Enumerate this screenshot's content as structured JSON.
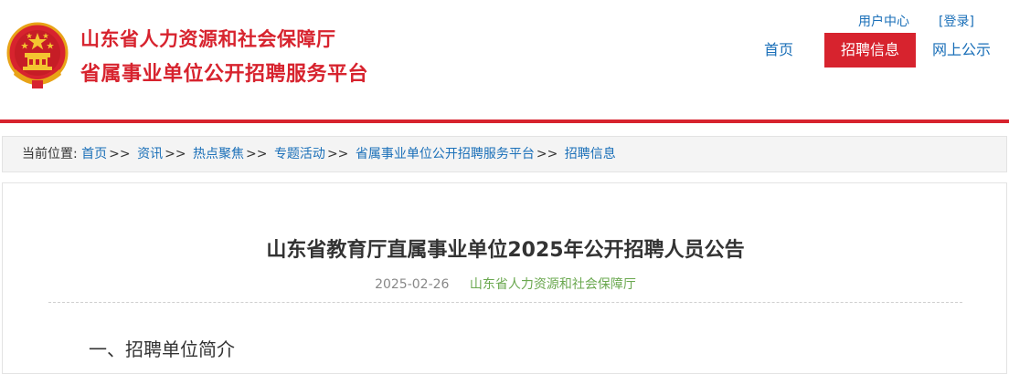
{
  "header": {
    "org_line1": "山东省人力资源和社会保障厅",
    "org_line2": "省属事业单位公开招聘服务平台",
    "user_center": "用户中心",
    "login": "[登录]",
    "nav": [
      "首页",
      "招聘信息",
      "网上公示"
    ],
    "active_nav": "招聘信息"
  },
  "breadcrumb": {
    "prefix": "当前位置:",
    "items": [
      "首页",
      "资讯",
      "热点聚焦",
      "专题活动",
      "省属事业单位公开招聘服务平台",
      "招聘信息"
    ],
    "separator": ">>"
  },
  "article": {
    "title": "山东省教育厅直属事业单位2025年公开招聘人员公告",
    "date": "2025-02-26",
    "source": "山东省人力资源和社会保障厅",
    "section_heading": "一、招聘单位简介"
  },
  "colors": {
    "brand_red": "#d7232e",
    "link_blue": "#1a6fb8",
    "source_green": "#6aa84f"
  },
  "icons": {
    "emblem": "national-emblem-icon"
  }
}
